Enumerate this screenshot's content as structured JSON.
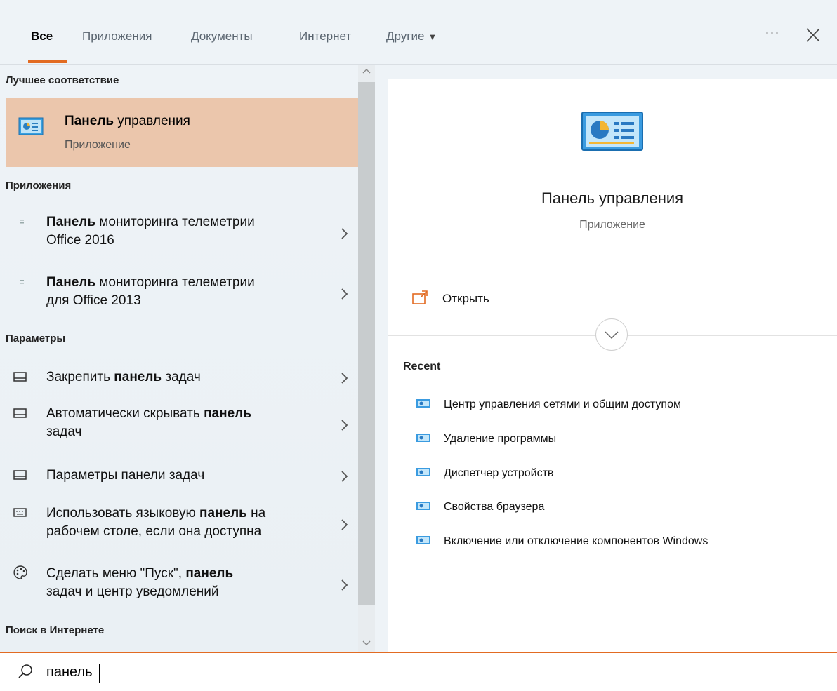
{
  "tabs": [
    {
      "label": "Все",
      "active": true
    },
    {
      "label": "Приложения"
    },
    {
      "label": "Документы"
    },
    {
      "label": "Интернет"
    },
    {
      "label": "Другие"
    }
  ],
  "more_label": "···",
  "sections": {
    "best_match": "Лучшее соответствие",
    "apps": "Приложения",
    "settings": "Параметры",
    "web": "Поиск в Интернете"
  },
  "best": {
    "title_bold": "Панель",
    "title_rest": " управления",
    "subtitle": "Приложение"
  },
  "apps": [
    {
      "bold": "Панель",
      "rest": " мониторинга телеметрии",
      "line2": "Office 2016"
    },
    {
      "bold": "Панель",
      "rest": " мониторинга телеметрии",
      "line2": "для Office 2013"
    }
  ],
  "settings": [
    {
      "pre": "Закрепить ",
      "bold": "панель",
      "post": " задач",
      "line2": "",
      "icon": "taskbar-icon"
    },
    {
      "pre": "Автоматически скрывать ",
      "bold": "панель",
      "post": "",
      "line2": "задач",
      "icon": "taskbar-icon"
    },
    {
      "pre": "Параметры панели задач",
      "bold": "",
      "post": "",
      "line2": "",
      "icon": "taskbar-icon"
    },
    {
      "pre": "Использовать языковую ",
      "bold": "панель",
      "post": " на",
      "line2": "рабочем столе, если она доступна",
      "icon": "keyboard-icon"
    },
    {
      "pre": "Сделать меню \"Пуск\", ",
      "bold": "панель",
      "post": "",
      "line2": "задач и центр уведомлений",
      "icon": "palette-icon"
    }
  ],
  "preview": {
    "title": "Панель управления",
    "subtitle": "Приложение",
    "open_label": "Открыть",
    "recent_head": "Recent",
    "recent": [
      "Центр управления сетями и общим доступом",
      "Удаление программы",
      "Диспетчер устройств",
      "Свойства браузера",
      "Включение или отключение компонентов Windows"
    ]
  },
  "search": {
    "value": "панель"
  },
  "colors": {
    "accent": "#e26b22",
    "highlight": "#ebc6ac"
  }
}
